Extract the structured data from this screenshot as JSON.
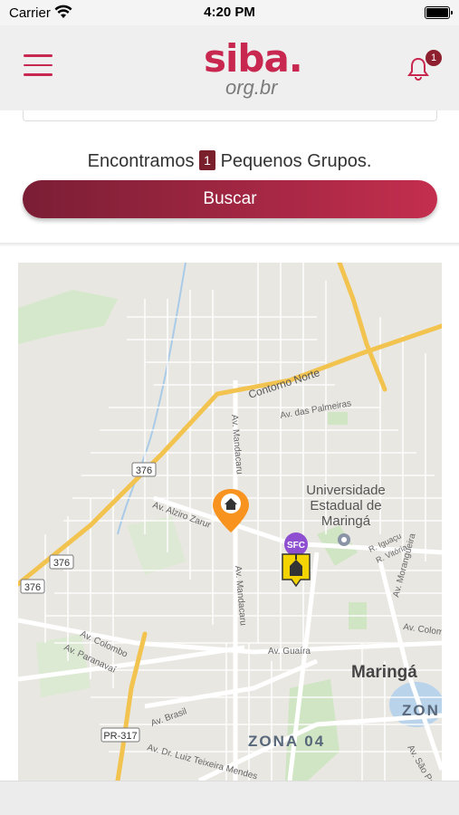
{
  "status_bar": {
    "carrier": "Carrier",
    "time": "4:20 PM"
  },
  "header": {
    "logo_main": "siba.",
    "logo_sub": "org.br",
    "notification_count": "1"
  },
  "results": {
    "prefix": "Encontramos",
    "count": "1",
    "suffix": "Pequenos Grupos."
  },
  "search_button": {
    "label": "Buscar"
  },
  "map": {
    "labels": {
      "contorno_norte": "Contorno Norte",
      "av_palmeiras": "Av. das Palmeiras",
      "av_mandacaru_1": "Av. Mandacaru",
      "av_mandacaru_2": "Av. Mandacaru",
      "av_alziro": "Av. Alziro Zarur",
      "univ_1": "Universidade",
      "univ_2": "Estadual de",
      "univ_3": "Maringá",
      "r_iguacu": "R. Iguaçu",
      "r_vitoria": "R. Vitória",
      "av_morangueira": "Av. Morangueira",
      "av_colombo": "Av. Colombo",
      "av_paranavai": "Av. Paranavaí",
      "av_guaira": "Av. Guaíra",
      "av_colombo_2": "Av. Colombo",
      "maringa": "Maringá",
      "zona_partial": "ZON",
      "zona_04": "ZONA 04",
      "av_brasil": "Av. Brasil",
      "av_luiz": "Av. Dr. Luiz Teixeira Mendes",
      "av_sao_paulo": "Av. São Paulo",
      "shield_376a": "376",
      "shield_376b": "376",
      "shield_376c": "376",
      "shield_pr317": "PR-317",
      "church_label": "SFC"
    },
    "colors": {
      "road_major": "#f2c34f",
      "road_white": "#ffffff",
      "park": "#cfe5c3",
      "water": "#a9cbe8",
      "home_marker": "#f7931e",
      "church_marker": "#f4d400"
    },
    "icons": [
      "home-marker-icon",
      "church-marker-icon",
      "map-pin-icon"
    ]
  },
  "brand_color": "#c8284f"
}
